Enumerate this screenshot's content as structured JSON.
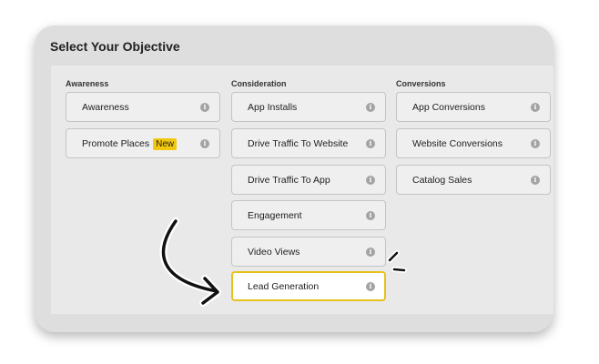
{
  "title": "Select Your Objective",
  "info_glyph": "i",
  "accent_color": "#f2c80f",
  "columns": [
    {
      "heading": "Awareness",
      "options": [
        {
          "label": "Awareness"
        },
        {
          "label": "Promote Places",
          "badge": "New"
        }
      ]
    },
    {
      "heading": "Consideration",
      "options": [
        {
          "label": "App Installs"
        },
        {
          "label": "Drive Traffic To Website"
        },
        {
          "label": "Drive Traffic To App"
        },
        {
          "label": "Engagement"
        },
        {
          "label": "Video Views"
        },
        {
          "label": "Lead Generation",
          "selected": true
        }
      ]
    },
    {
      "heading": "Conversions",
      "options": [
        {
          "label": "App Conversions"
        },
        {
          "label": "Website Conversions"
        },
        {
          "label": "Catalog Sales"
        }
      ]
    }
  ]
}
